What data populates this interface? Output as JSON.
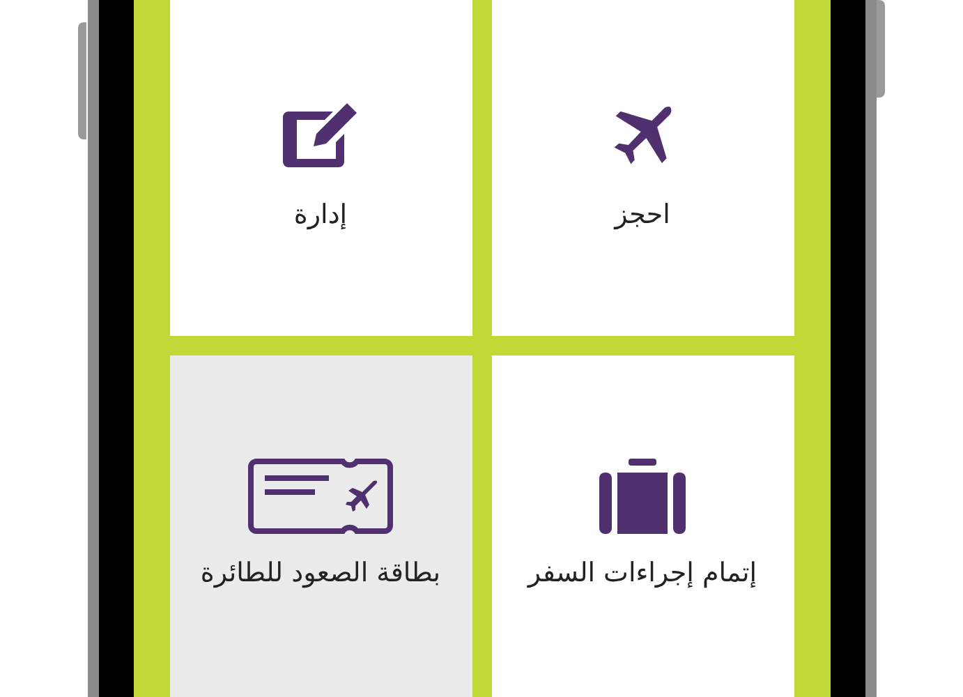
{
  "tiles": [
    {
      "kind": "plane",
      "label": "احجز",
      "selected": false
    },
    {
      "kind": "edit",
      "label": "إدارة",
      "selected": false
    },
    {
      "kind": "suitcase",
      "label": "إتمام إجراءات السفر",
      "selected": false
    },
    {
      "kind": "ticket",
      "label": "بطاقة الصعود للطائرة",
      "selected": true
    }
  ]
}
